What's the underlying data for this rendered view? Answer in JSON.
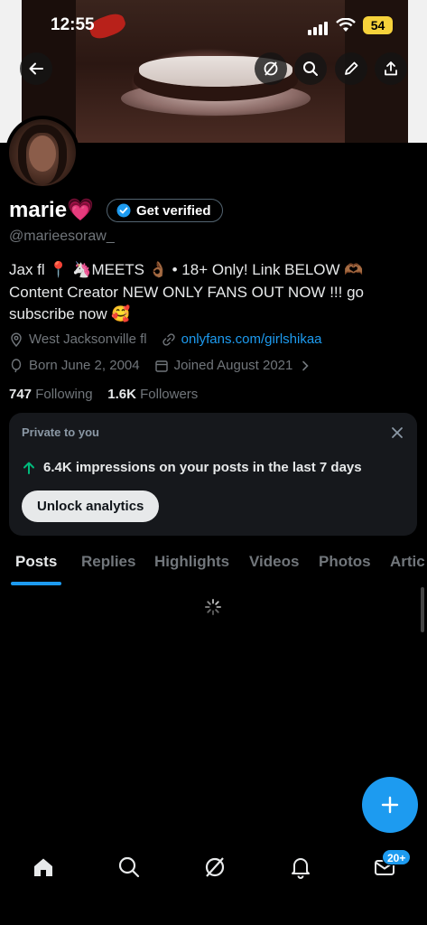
{
  "status_bar": {
    "time": "12:55",
    "battery": "54"
  },
  "profile": {
    "name": "marie💗",
    "verified_button": "Get verified",
    "handle": "@marieesoraw_",
    "bio": "Jax fl 📍 🦄MEETS 👌🏾 • 18+ Only! Link BELOW 🫶🏾 Content Creator NEW ONLY FANS OUT NOW !!! go subscribe now 🥰",
    "location": "West Jacksonville fl",
    "link": "onlyfans.com/girlshikaa",
    "born": "Born June 2, 2004",
    "joined": "Joined August 2021",
    "following_count": "747",
    "following_label": "Following",
    "followers_count": "1.6K",
    "followers_label": "Followers"
  },
  "analytics_card": {
    "label": "Private to you",
    "stat": "6.4K impressions on your posts in the last 7 days",
    "button": "Unlock analytics"
  },
  "tabs": [
    {
      "label": "Posts",
      "active": true
    },
    {
      "label": "Replies"
    },
    {
      "label": "Highlights"
    },
    {
      "label": "Videos"
    },
    {
      "label": "Photos"
    },
    {
      "label": "Artic"
    }
  ],
  "nav": {
    "messages_badge": "20+"
  },
  "colors": {
    "accent": "#1d9bf0",
    "background": "#000000",
    "muted": "#71767b",
    "card": "#16181c"
  }
}
